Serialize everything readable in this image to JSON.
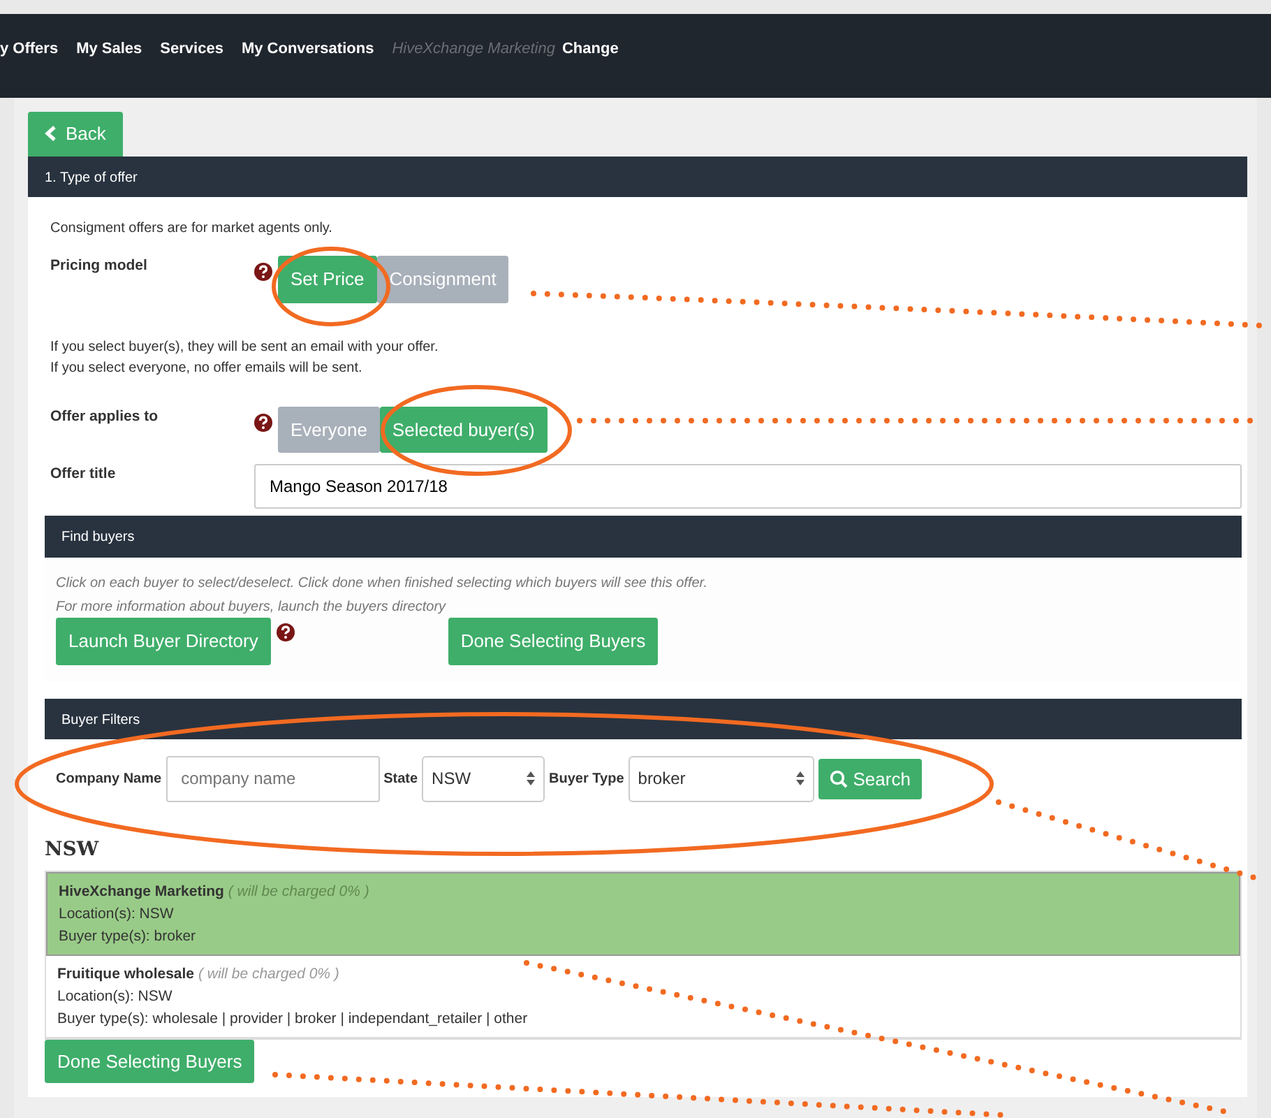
{
  "nav": {
    "items": [
      {
        "label": "y Offers"
      },
      {
        "label": "My Sales"
      },
      {
        "label": "Services"
      },
      {
        "label": "My Conversations"
      }
    ],
    "account": "HiveXchange Marketing",
    "change": "Change"
  },
  "back_button": "Back",
  "type_of_offer": {
    "title": "1. Type of offer",
    "note": "Consigment offers are for market agents only.",
    "pricing_model": {
      "label": "Pricing model",
      "options": [
        {
          "label": "Set Price",
          "selected": true
        },
        {
          "label": "Consignment",
          "selected": false
        }
      ]
    },
    "email_notes": [
      "If you select buyer(s), they will be sent an email with your offer.",
      "If you select everyone, no offer emails will be sent."
    ],
    "offer_applies_to": {
      "label": "Offer applies to",
      "options": [
        {
          "label": "Everyone",
          "selected": false
        },
        {
          "label": "Selected buyer(s)",
          "selected": true
        }
      ]
    },
    "offer_title": {
      "label": "Offer title",
      "value": "Mango Season 2017/18"
    }
  },
  "find_buyers": {
    "title": "Find buyers",
    "hints": [
      "Click on each buyer to select/deselect. Click done when finished selecting which buyers will see this offer.",
      "For more information about buyers, launch the buyers directory"
    ],
    "launch_button": "Launch Buyer Directory",
    "done_button": "Done Selecting Buyers"
  },
  "buyer_filters": {
    "title": "Buyer Filters",
    "company_name": {
      "label": "Company Name",
      "placeholder": "company name"
    },
    "state": {
      "label": "State",
      "value": "NSW"
    },
    "buyer_type": {
      "label": "Buyer Type",
      "value": "broker"
    },
    "search_button": "Search"
  },
  "results": {
    "heading": "NSW",
    "buyers": [
      {
        "name": "HiveXchange Marketing",
        "charge": "( will be charged 0% )",
        "location": "Location(s): NSW",
        "types": "Buyer type(s): broker",
        "selected": true
      },
      {
        "name": "Fruitique wholesale",
        "charge": "( will be charged 0% )",
        "location": "Location(s): NSW",
        "types": "Buyer type(s): wholesale | provider | broker | independant_retailer | other",
        "selected": false
      }
    ],
    "done_button": "Done Selecting Buyers"
  }
}
